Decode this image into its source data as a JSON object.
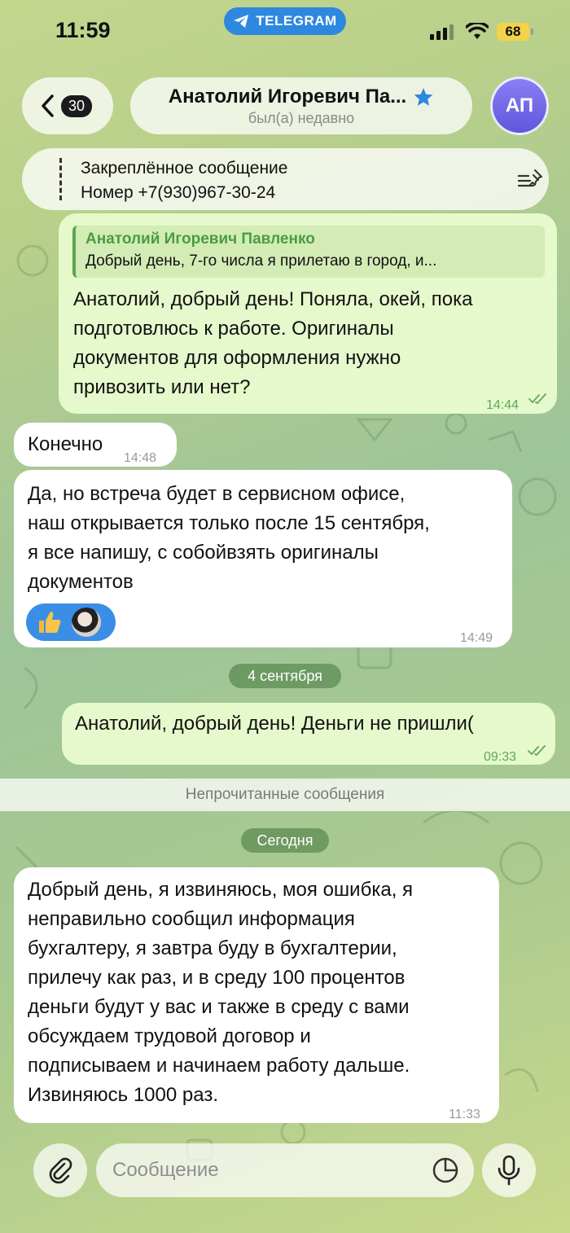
{
  "status_bar": {
    "time": "11:59",
    "app_label": "TELEGRAM",
    "battery": "68"
  },
  "header": {
    "back_count": "30",
    "contact_name": "Анатолий Игоревич Па...",
    "contact_status": "был(а) недавно",
    "avatar_initials": "АП"
  },
  "pinned": {
    "title": "Закреплённое сообщение",
    "text": "Номер +7(930)967-30-24"
  },
  "messages": [
    {
      "direction": "out",
      "reply": {
        "name": "Анатолий Игоревич Павленко",
        "text": "Добрый день, 7-го числа я прилетаю в город, и..."
      },
      "lines": [
        "Анатолий, добрый день! Поняла, окей, пока",
        "подготовлюсь к работе. Оригиналы",
        "документов для оформления нужно",
        "привозить или нет?"
      ],
      "time": "14:44",
      "read": true
    },
    {
      "direction": "in",
      "lines": [
        "Конечно"
      ],
      "time": "14:48"
    },
    {
      "direction": "in",
      "lines": [
        "Да, но встреча будет в сервисном офисе,",
        "наш открывается только после 15 сентября,",
        "я все напишу, с собойвзять оригиналы",
        "документов"
      ],
      "time": "14:49",
      "reactions": [
        "thumbs-up",
        "user-avatar"
      ]
    },
    {
      "direction": "out",
      "lines": [
        "Анатолий, добрый день! Деньги не пришли("
      ],
      "time": "09:33",
      "read": true
    },
    {
      "direction": "in",
      "lines": [
        "Добрый день,  я извиняюсь, моя ошибка, я",
        "неправильно сообщил информация",
        "бухгалтеру, я завтра буду в бухгалтерии,",
        "прилечу как раз, и в среду 100 процентов",
        "деньги будут у вас и также в среду с вами",
        "обсуждаем трудовой договор и",
        "подписываем и начинаем работу дальше.",
        "Извиняюсь 1000 раз."
      ],
      "time": "11:33"
    }
  ],
  "separators": {
    "date_1": "4 сентября",
    "unread": "Непрочитанные сообщения",
    "date_2": "Сегодня"
  },
  "composer": {
    "placeholder": "Сообщение",
    "value": ""
  },
  "colors": {
    "outgoing_bubble": "#e6f9cc",
    "incoming_bubble": "#ffffff",
    "accent_blue": "#2e88e0",
    "read_check": "#5fa85a",
    "avatar": "#7066e8"
  },
  "icons": [
    "back-chevron-icon",
    "star-icon",
    "pin-list-icon",
    "paperclip-icon",
    "sticker-icon",
    "microphone-icon",
    "double-check-icon",
    "telegram-plane-icon",
    "signal-icon",
    "wifi-icon"
  ]
}
